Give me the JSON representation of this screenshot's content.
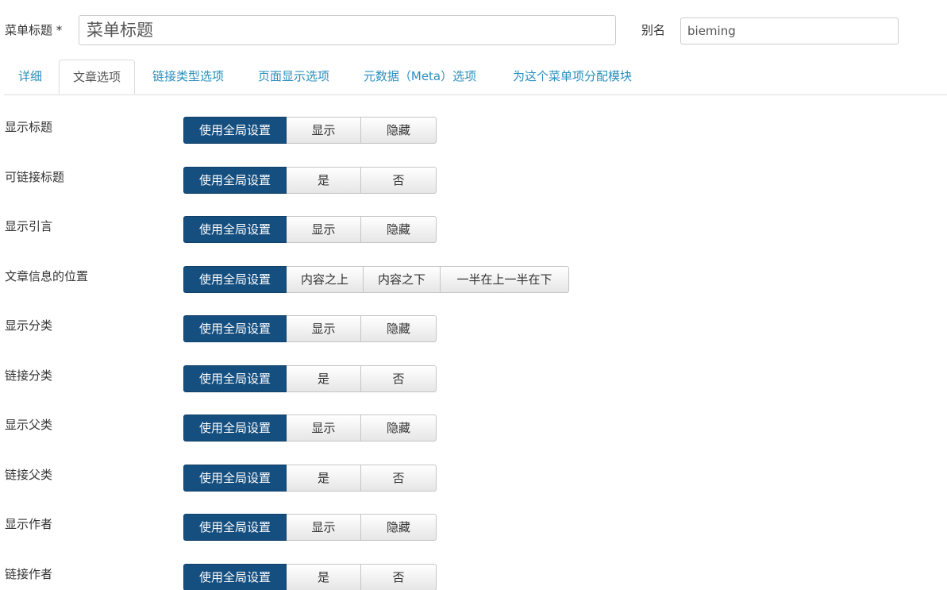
{
  "header": {
    "title_label": "菜单标题 *",
    "title_value": "菜单标题",
    "alias_label": "别名",
    "alias_value": "bieming"
  },
  "tabs": [
    {
      "label": "详细",
      "active": false
    },
    {
      "label": "文章选项",
      "active": true
    },
    {
      "label": "链接类型选项",
      "active": false
    },
    {
      "label": "页面显示选项",
      "active": false
    },
    {
      "label": "元数据（Meta）选项",
      "active": false
    },
    {
      "label": "为这个菜单项分配模块",
      "active": false
    }
  ],
  "options": [
    {
      "label": "显示标题",
      "buttons": [
        "使用全局设置",
        "显示",
        "隐藏"
      ],
      "selected": 0
    },
    {
      "label": "可链接标题",
      "buttons": [
        "使用全局设置",
        "是",
        "否"
      ],
      "selected": 0
    },
    {
      "label": "显示引言",
      "buttons": [
        "使用全局设置",
        "显示",
        "隐藏"
      ],
      "selected": 0
    },
    {
      "label": "文章信息的位置",
      "buttons": [
        "使用全局设置",
        "内容之上",
        "内容之下",
        "一半在上一半在下"
      ],
      "selected": 0
    },
    {
      "label": "显示分类",
      "buttons": [
        "使用全局设置",
        "显示",
        "隐藏"
      ],
      "selected": 0
    },
    {
      "label": "链接分类",
      "buttons": [
        "使用全局设置",
        "是",
        "否"
      ],
      "selected": 0
    },
    {
      "label": "显示父类",
      "buttons": [
        "使用全局设置",
        "显示",
        "隐藏"
      ],
      "selected": 0
    },
    {
      "label": "链接父类",
      "buttons": [
        "使用全局设置",
        "是",
        "否"
      ],
      "selected": 0
    },
    {
      "label": "显示作者",
      "buttons": [
        "使用全局设置",
        "显示",
        "隐藏"
      ],
      "selected": 0
    },
    {
      "label": "链接作者",
      "buttons": [
        "使用全局设置",
        "是",
        "否"
      ],
      "selected": 0
    }
  ],
  "colors": {
    "active_button": "#154f80",
    "tab_link": "#2a8fbd"
  }
}
